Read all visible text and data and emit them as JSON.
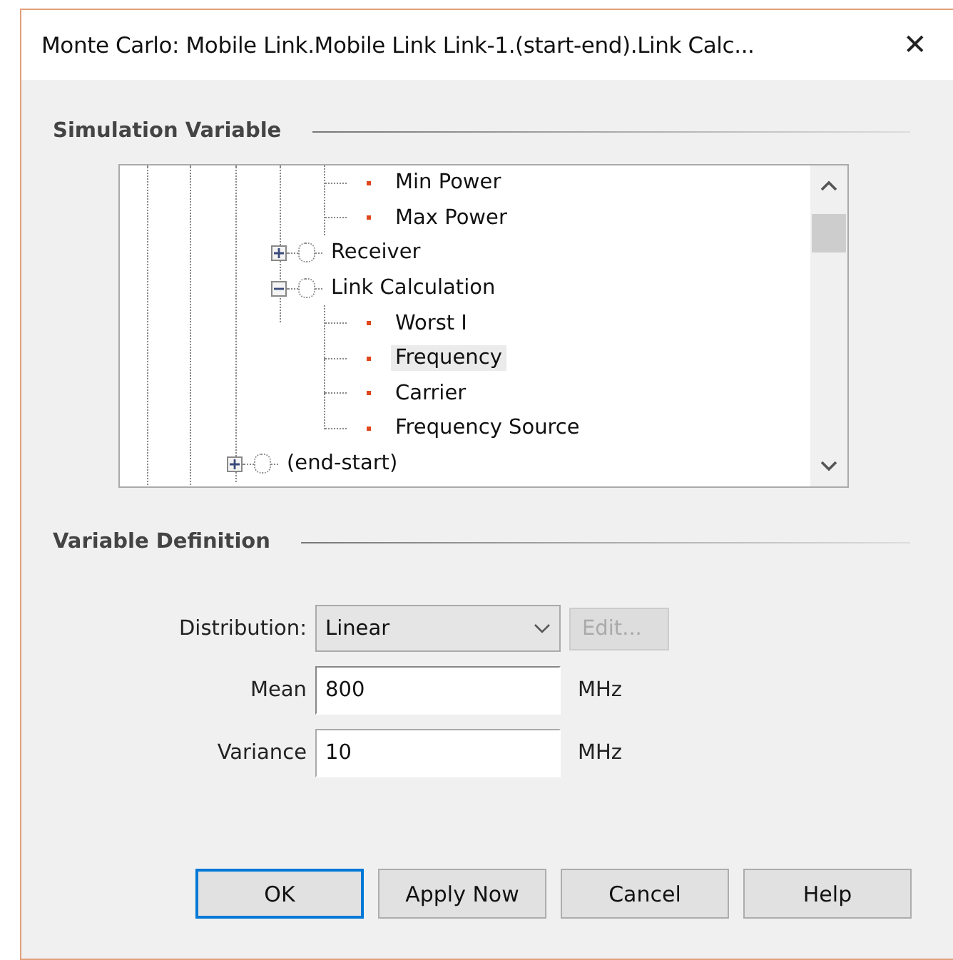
{
  "window": {
    "title": "Monte Carlo: Mobile Link.Mobile Link Link-1.(start-end).Link Calc...",
    "close": "✕"
  },
  "simulation_variable": {
    "heading": "Simulation Variable",
    "tree": [
      {
        "kind": "leaf",
        "label": "Min Power",
        "selected": false
      },
      {
        "kind": "leaf",
        "label": "Max Power",
        "selected": false
      },
      {
        "kind": "group",
        "label": "Receiver",
        "expanded": false
      },
      {
        "kind": "group",
        "label": "Link Calculation",
        "expanded": true,
        "children": [
          {
            "kind": "leaf",
            "label": "Worst I",
            "selected": false
          },
          {
            "kind": "leaf",
            "label": "Frequency",
            "selected": true
          },
          {
            "kind": "leaf",
            "label": "Carrier",
            "selected": false
          },
          {
            "kind": "leaf",
            "label": "Frequency Source",
            "selected": false
          }
        ]
      },
      {
        "kind": "outer-group",
        "label": "(end-start)",
        "expanded": false
      }
    ]
  },
  "variable_definition": {
    "heading": "Variable Definition",
    "distribution": {
      "label": "Distribution:",
      "value": "Linear",
      "edit_button": {
        "label": "Edit...",
        "disabled": true
      }
    },
    "fields": [
      {
        "label": "Mean",
        "value": "800",
        "unit": "MHz",
        "focused": true
      },
      {
        "label": "Variance",
        "value": "10",
        "unit": "MHz",
        "focused": false
      }
    ]
  },
  "buttons": [
    {
      "label": "OK",
      "default": true
    },
    {
      "label": "Apply Now",
      "default": false
    },
    {
      "label": "Cancel",
      "default": false
    },
    {
      "label": "Help",
      "default": false
    }
  ]
}
